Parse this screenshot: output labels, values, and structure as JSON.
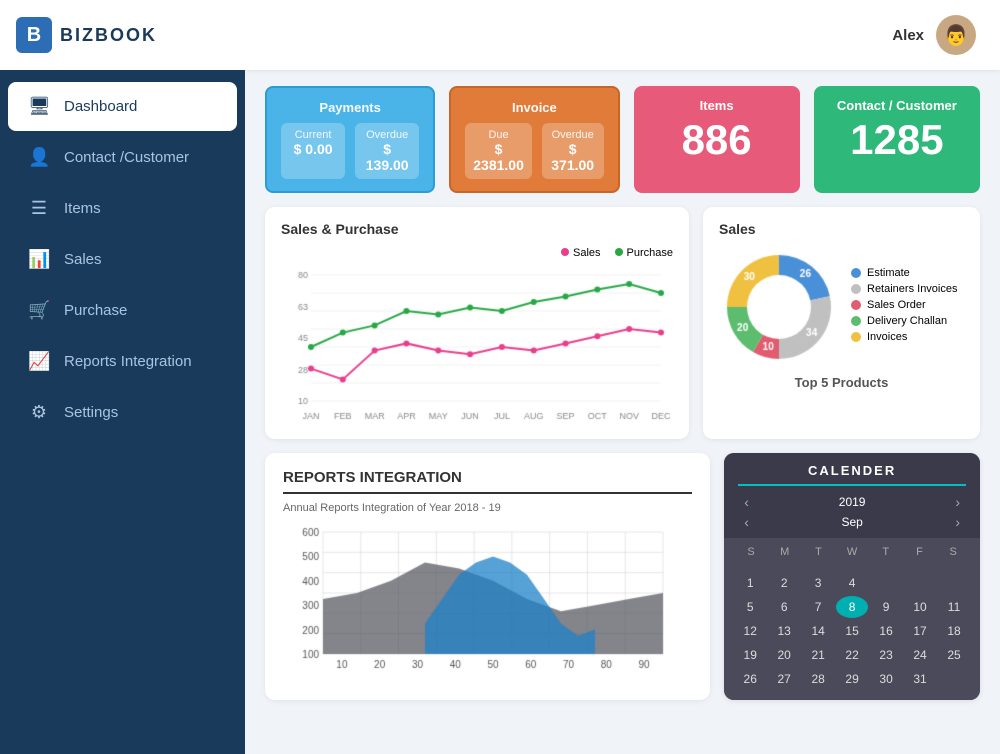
{
  "app": {
    "logo_letter": "B",
    "logo_text": "BIZBOOK",
    "user_name": "Alex"
  },
  "sidebar": {
    "items": [
      {
        "id": "dashboard",
        "label": "Dashboard",
        "icon": "🖥",
        "active": true
      },
      {
        "id": "contact",
        "label": "Contact /Customer",
        "icon": "👤",
        "active": false
      },
      {
        "id": "items",
        "label": "Items",
        "icon": "☰",
        "active": false
      },
      {
        "id": "sales",
        "label": "Sales",
        "icon": "📊",
        "active": false
      },
      {
        "id": "purchase",
        "label": "Purchase",
        "icon": "🛒",
        "active": false
      },
      {
        "id": "reports",
        "label": "Reports Integration",
        "icon": "📈",
        "active": false
      },
      {
        "id": "settings",
        "label": "Settings",
        "icon": "⚙",
        "active": false
      }
    ]
  },
  "stat_cards": {
    "payments": {
      "title": "Payments",
      "current_label": "Current",
      "current_value": "$ 0.00",
      "overdue_label": "Overdue",
      "overdue_value": "$ 139.00"
    },
    "invoice": {
      "title": "Invoice",
      "due_label": "Due",
      "due_value": "$ 2381.00",
      "overdue_label": "Overdue",
      "overdue_value": "$ 371.00"
    },
    "items": {
      "title": "Items",
      "value": "886"
    },
    "contact": {
      "title": "Contact / Customer",
      "value": "1285"
    }
  },
  "sales_purchase_chart": {
    "title": "Sales & Purchase",
    "legend": [
      {
        "label": "Sales",
        "color": "#e83e8c"
      },
      {
        "label": "Purchase",
        "color": "#28a745"
      }
    ],
    "months": [
      "JAN",
      "FEB",
      "MAR",
      "APR",
      "MAY",
      "JUN",
      "JUL",
      "AUG",
      "SEP",
      "OCT",
      "NOV",
      "DEC"
    ],
    "sales_data": [
      28,
      22,
      38,
      42,
      38,
      36,
      40,
      38,
      42,
      46,
      50,
      48
    ],
    "purchase_data": [
      40,
      48,
      52,
      60,
      58,
      62,
      60,
      65,
      68,
      72,
      75,
      70
    ]
  },
  "donut_chart": {
    "title": "Sales",
    "segments": [
      {
        "label": "Estimate",
        "color": "#4a90d9",
        "value": 26,
        "pct": 26
      },
      {
        "label": "Retainers Invoices",
        "color": "#c0c0c0",
        "value": 34,
        "pct": 34
      },
      {
        "label": "Sales Order",
        "color": "#e05c6e",
        "value": 10,
        "pct": 10
      },
      {
        "label": "Delivery Challan",
        "color": "#5cbd6e",
        "value": 20,
        "pct": 20
      },
      {
        "label": "Invoices",
        "color": "#f0c040",
        "value": 30,
        "pct": 30
      }
    ],
    "sub_title": "Top 5 Products"
  },
  "reports_integration": {
    "title": "REPORTS INTEGRATION",
    "subtitle": "Annual Reports Integration of Year 2018 - 19",
    "y_labels": [
      "600",
      "500",
      "400",
      "300",
      "200",
      "100"
    ],
    "x_labels": [
      "10",
      "20",
      "30",
      "40",
      "50",
      "60",
      "70",
      "80",
      "90"
    ]
  },
  "calendar": {
    "title": "CALENDER",
    "year": "2019",
    "month": "Sep",
    "day_headers": [
      "S",
      "M",
      "T",
      "W",
      "T",
      "F",
      "S"
    ],
    "days": [
      "",
      "",
      "",
      "",
      "",
      "",
      "",
      "1",
      "2",
      "3",
      "4",
      "",
      "",
      "",
      "5",
      "6",
      "7",
      "8",
      "9",
      "10",
      "11",
      "12",
      "13",
      "14",
      "15",
      "16",
      "17",
      "18",
      "19",
      "20",
      "21",
      "22",
      "23",
      "24",
      "25",
      "26",
      "27",
      "28",
      "29",
      "30",
      "31",
      ""
    ],
    "today": "8"
  }
}
